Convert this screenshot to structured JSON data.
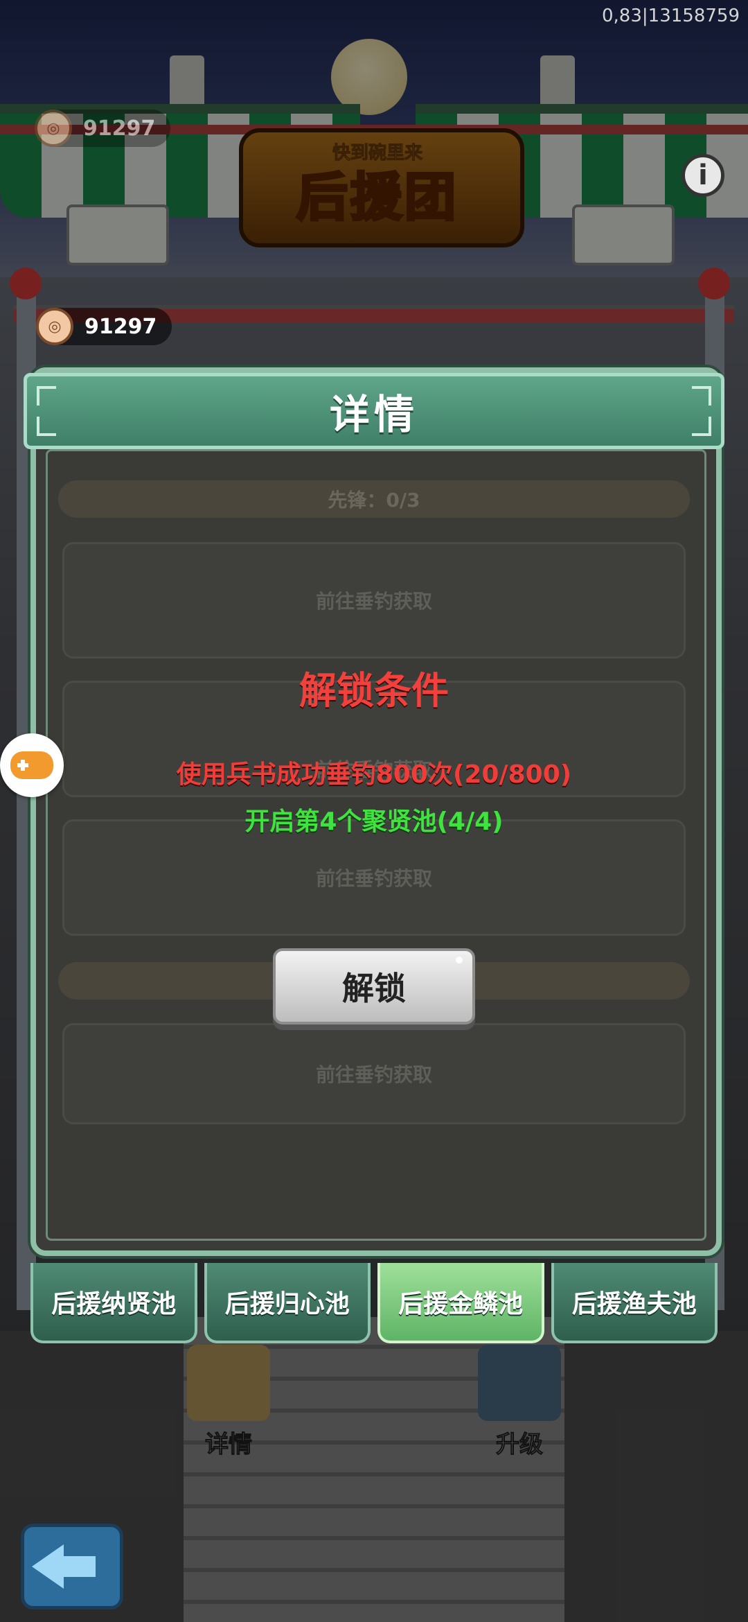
{
  "status": {
    "build_id": "0,83|13158759"
  },
  "hud": {
    "currency_top": "91297",
    "currency": "91297",
    "info_label": "i"
  },
  "banner": {
    "subtitle": "快到碗里来",
    "title": "后援团"
  },
  "modal": {
    "title": "详情",
    "section1": "先锋：0/3",
    "slot_text": "前往垂钓获取",
    "lock_title": "解锁条件",
    "condition1": "使用兵书成功垂钓800次(20/800)",
    "condition2": "开启第4个聚贤池(4/4)",
    "unlock_button": "解锁"
  },
  "tabs": [
    {
      "label": "后援纳贤池",
      "active": false
    },
    {
      "label": "后援归心池",
      "active": false
    },
    {
      "label": "后援金鳞池",
      "active": true
    },
    {
      "label": "后援渔夫池",
      "active": false
    }
  ],
  "dock": {
    "details_label": "详情",
    "upgrade_label": "升级"
  },
  "colors": {
    "modal_header": "#4f917a",
    "lock_red": "#ef3e3a",
    "condition_green": "#3fe23f",
    "active_tab": "#7cc87a"
  }
}
